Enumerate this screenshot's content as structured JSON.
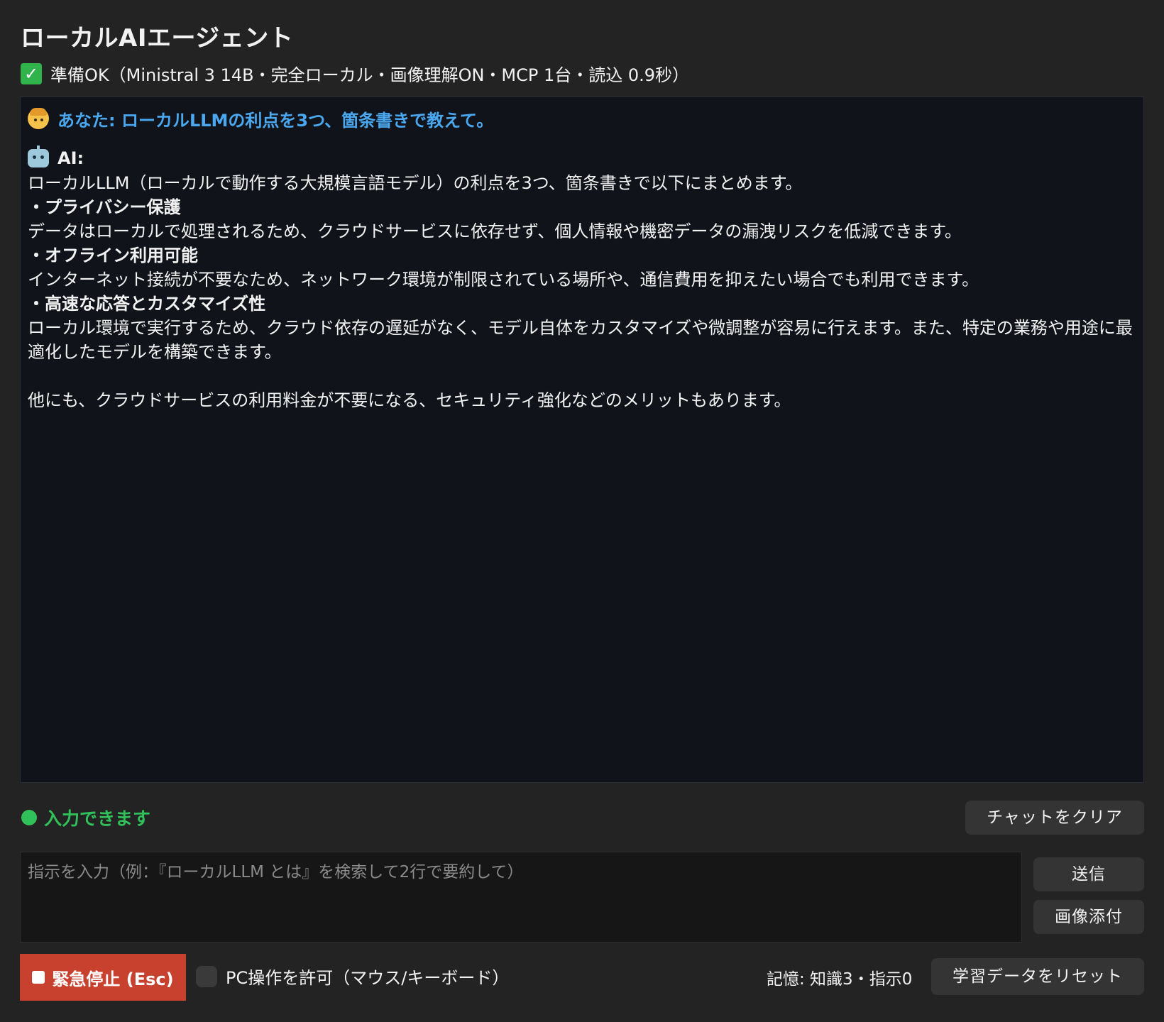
{
  "app": {
    "title": "ローカルAIエージェント",
    "status": "準備OK（Ministral 3 14B・完全ローカル・画像理解ON・MCP 1台・読込 0.9秒）",
    "status_icon": "check-icon"
  },
  "chat": {
    "user_message": {
      "icon": "person-icon",
      "text": "あなた: ローカルLLMの利点を3つ、箇条書きで教えて。"
    },
    "ai_message": {
      "icon": "robot-icon",
      "speaker": "AI:",
      "intro": "ローカルLLM（ローカルで動作する大規模言語モデル）の利点を3つ、箇条書きで以下にまとめます。",
      "points": [
        {
          "heading": "・プライバシー保護",
          "body": "データはローカルで処理されるため、クラウドサービスに依存せず、個人情報や機密データの漏洩リスクを低減できます。"
        },
        {
          "heading": "・オフライン利用可能",
          "body": "インターネット接続が不要なため、ネットワーク環境が制限されている場所や、通信費用を抑えたい場合でも利用できます。"
        },
        {
          "heading": "・高速な応答とカスタマイズ性",
          "body": "ローカル環境で実行するため、クラウド依存の遅延がなく、モデル自体をカスタマイズや微調整が容易に行えます。また、特定の業務や用途に最適化したモデルを構築できます。"
        }
      ],
      "closing": "他にも、クラウドサービスの利用料金が不要になる、セキュリティ強化などのメリットもあります。"
    }
  },
  "controls": {
    "ready_text": "入力できます",
    "clear_label": "チャットをクリア",
    "input_placeholder": "指示を入力（例：『ローカルLLM とは』を検索して2行で要約して）",
    "input_value": "",
    "send_label": "送信",
    "attach_label": "画像添付",
    "stop_label": "緊急停止 (Esc)",
    "pc_control_label": "PC操作を許可（マウス/キーボード）",
    "pc_control_checked": false,
    "memory_text": "記憶: 知識3・指示0",
    "reset_label": "学習データをリセット"
  },
  "colors": {
    "background": "#232323",
    "chat_background": "#10131a",
    "user_text": "#4aa8f0",
    "ready_green": "#31c15a",
    "stop_red": "#c8402e"
  }
}
